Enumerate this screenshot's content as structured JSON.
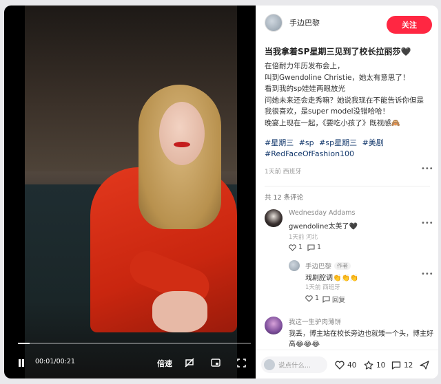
{
  "player": {
    "time": "00:01/00:21",
    "speed_label": "倍速",
    "progress_fraction": 0.05
  },
  "author": {
    "name": "手边巴黎",
    "follow_label": "关注"
  },
  "post": {
    "title": "当我拿着SP星期三见到了校长拉丽莎🖤",
    "body_lines": [
      "在倍耐力年历发布会上，",
      "叫到Gwendoline Christie，她太有意思了！",
      "看到我的sp娃娃两眼放光",
      "问她未来还会走秀嘛？她说我现在不能告诉你但是",
      "我很喜欢，是super model没错哈哈！",
      "晚宴上现在一起，《要吃小孩了》既视感🙈"
    ],
    "tags": [
      "#星期三",
      "#sp",
      "#sp星期三",
      "#美剧",
      "#RedFaceOfFashion100"
    ],
    "meta": "1天前 西班牙"
  },
  "comments": {
    "count_label": "共 12 条评论",
    "items": [
      {
        "name": "Wednesday Addams",
        "text": "gwendoline太美了🖤",
        "meta": "1天前 河北",
        "likes": "1",
        "replies": "1"
      },
      {
        "name": "手边巴黎",
        "badge": "作者",
        "text": "戏剧腔调👏👏👏",
        "meta": "1天前 西班牙",
        "likes": "1",
        "reply_label": "回复"
      },
      {
        "name": "我这一生驴肉薄饼",
        "text_line1": "我丢，博主站在校长旁边也就矮一个头，博主好",
        "text_line2": "高😂😂😂"
      }
    ]
  },
  "footer": {
    "placeholder": "说点什么...",
    "likes": "40",
    "stars": "10",
    "comments": "12"
  },
  "colors": {
    "accent": "#ff2742",
    "tag": "#13386c"
  }
}
